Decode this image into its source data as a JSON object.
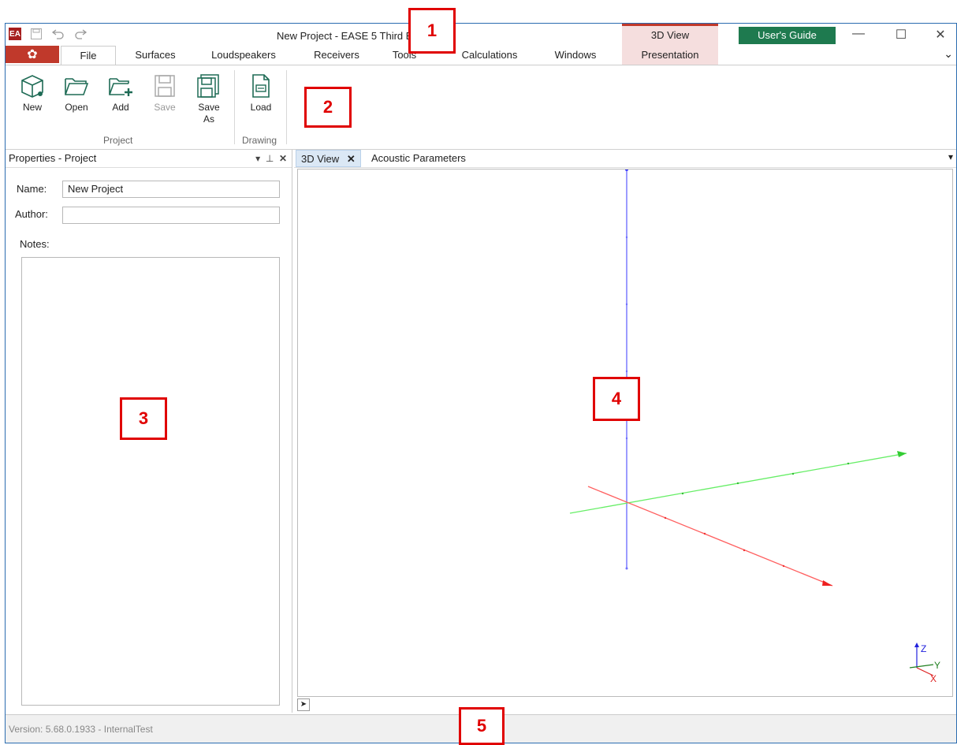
{
  "titlebar": {
    "logo": "EASE-logo",
    "title": "New Project - EASE 5 Third E",
    "context_tab_group": "3D View",
    "users_guide": "User's Guide",
    "minimize": "—",
    "maximize": "☐",
    "close": "✕"
  },
  "tabs": [
    "File",
    "Surfaces",
    "Loudspeakers",
    "Receivers",
    "Tools",
    "Calculations",
    "Windows"
  ],
  "context_tab": "Presentation",
  "ribbon": {
    "buttons": [
      {
        "label": "New",
        "icon": "new-cube-icon",
        "enabled": true
      },
      {
        "label": "Open",
        "icon": "folder-open-icon",
        "enabled": true
      },
      {
        "label": "Add",
        "icon": "folder-add-icon",
        "enabled": true
      },
      {
        "label": "Save",
        "icon": "save-icon",
        "enabled": false
      },
      {
        "label": "Save As",
        "icon": "save-as-icon",
        "enabled": true
      },
      {
        "label": "Load",
        "icon": "load-drawing-icon",
        "enabled": true
      }
    ],
    "groups": [
      "Project",
      "Drawing"
    ]
  },
  "properties": {
    "title": "Properties - Project",
    "name_label": "Name:",
    "name_value": "New Project",
    "author_label": "Author:",
    "author_value": "",
    "notes_label": "Notes:"
  },
  "doc": {
    "tabs": [
      "3D View",
      "Acoustic Parameters"
    ],
    "axes": {
      "x": "X",
      "y": "Y",
      "z": "Z"
    }
  },
  "status": {
    "version": "Version: 5.68.0.1933 - InternalTest"
  },
  "callouts": [
    "1",
    "2",
    "3",
    "4",
    "5"
  ],
  "colors": {
    "accent_red": "#c0392b",
    "guide_green": "#1e7a4f",
    "axis_x": "#ff4040",
    "axis_y": "#40e040",
    "axis_z": "#6060ff",
    "callout": "#e00000"
  }
}
